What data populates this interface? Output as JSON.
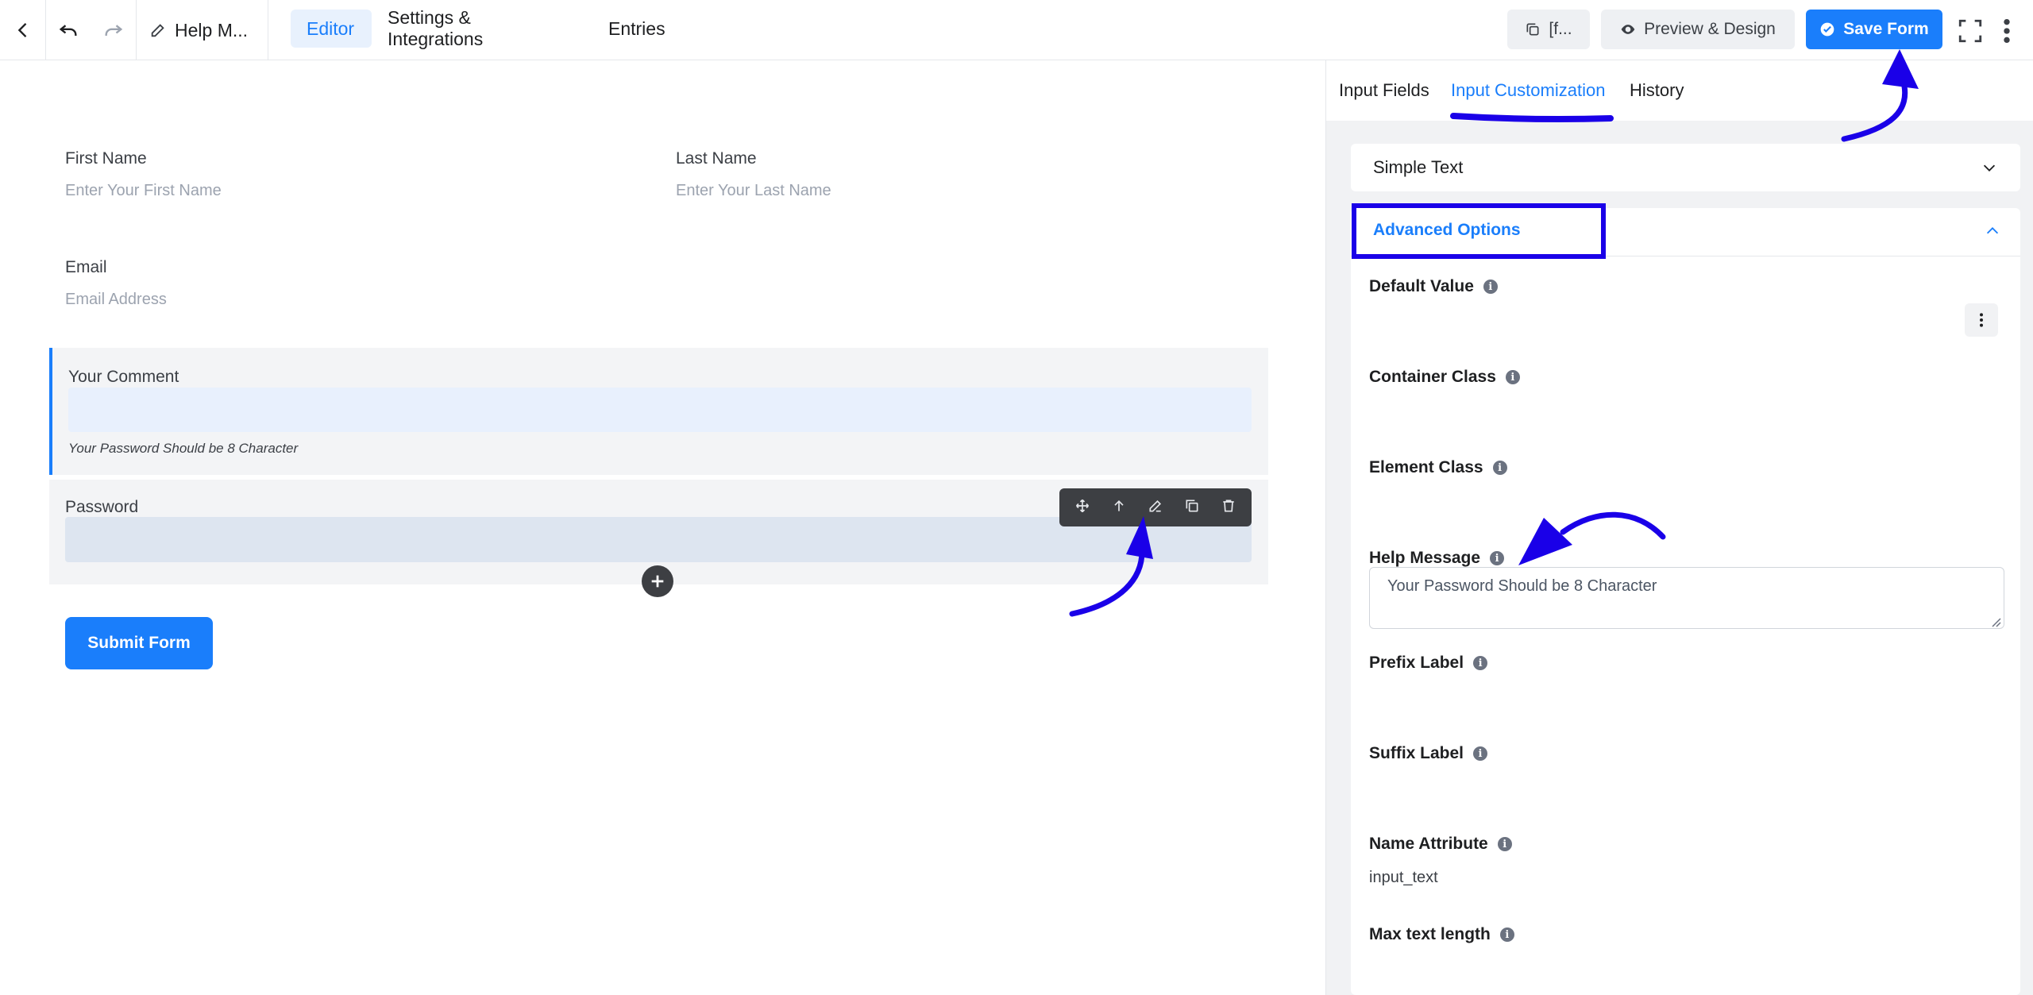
{
  "topbar": {
    "title": "Help M...",
    "tabs": [
      {
        "label": "Editor",
        "active": true
      },
      {
        "label": "Settings & Integrations",
        "active": false
      },
      {
        "label": "Entries",
        "active": false
      }
    ],
    "shortcode_label": "[f...",
    "preview_label": "Preview & Design",
    "save_label": "Save Form"
  },
  "form": {
    "first_name": {
      "label": "First Name",
      "placeholder": "Enter Your First Name"
    },
    "last_name": {
      "label": "Last Name",
      "placeholder": "Enter Your Last Name"
    },
    "email": {
      "label": "Email",
      "placeholder": "Email Address"
    },
    "comment": {
      "label": "Your Comment",
      "help": "Your Password Should be 8 Character"
    },
    "password": {
      "label": "Password"
    },
    "submit_label": "Submit Form"
  },
  "panel": {
    "tabs": [
      {
        "label": "Input Fields",
        "active": false
      },
      {
        "label": "Input Customization",
        "active": true
      },
      {
        "label": "History",
        "active": false
      }
    ],
    "simple_text": "Simple Text",
    "advanced_title": "Advanced Options",
    "options": {
      "default_value": "Default Value",
      "container_class": "Container Class",
      "element_class": "Element Class",
      "help_message": "Help Message",
      "help_message_value": "Your Password Should be 8 Character",
      "prefix_label": "Prefix Label",
      "suffix_label": "Suffix Label",
      "name_attribute": "Name Attribute",
      "name_attribute_value": "input_text",
      "max_text_length": "Max text length"
    }
  },
  "colors": {
    "accent": "#1a7efb",
    "annotation": "#1a00e8"
  }
}
